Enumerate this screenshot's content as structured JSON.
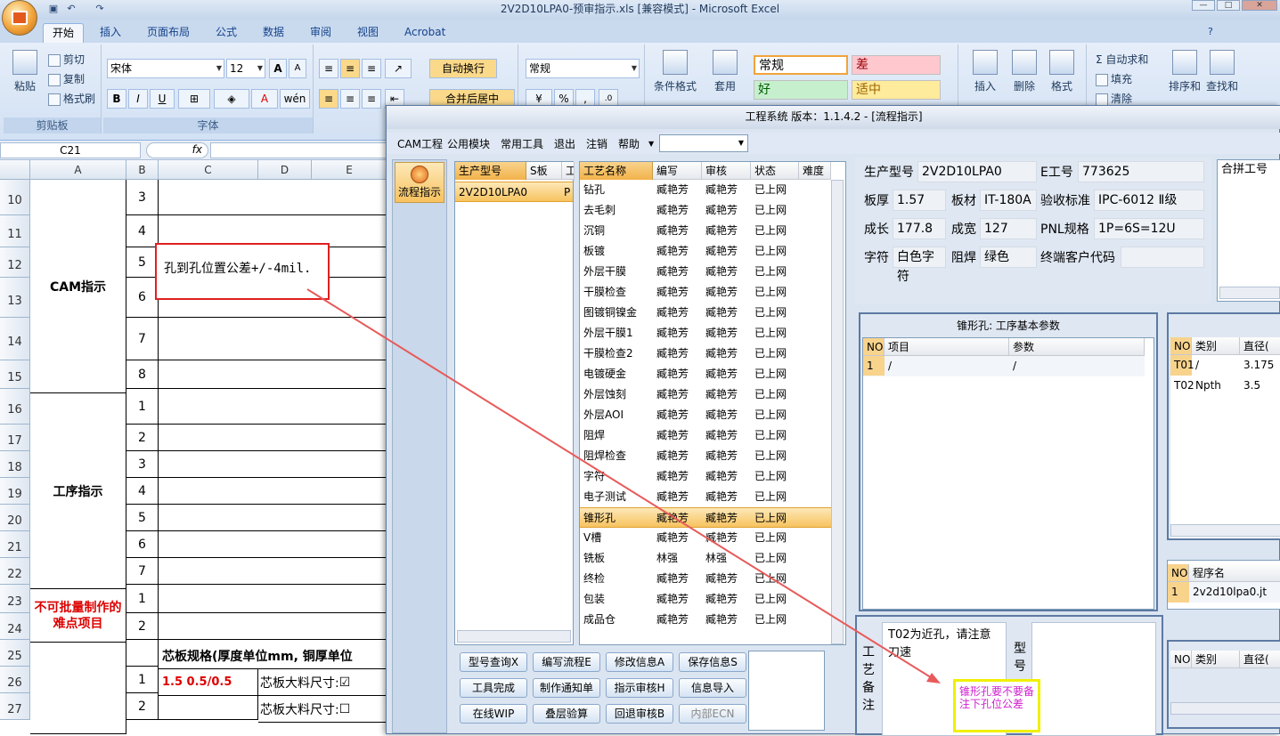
{
  "excel": {
    "title": "2V2D10LPA0-预审指示.xls  [兼容模式] - Microsoft Excel",
    "tabs": [
      "开始",
      "插入",
      "页面布局",
      "公式",
      "数据",
      "审阅",
      "视图",
      "Acrobat"
    ],
    "clipboard": {
      "paste": "粘贴",
      "cut": "剪切",
      "copy": "复制",
      "format_painter": "格式刷",
      "group": "剪贴板"
    },
    "font": {
      "name": "宋体",
      "size": "12",
      "bold": "B",
      "italic": "I",
      "underline": "U",
      "grow": "A",
      "shrink": "A",
      "group": "字体"
    },
    "align": {
      "wrap": "自动换行",
      "merge": "合并后居中"
    },
    "number": {
      "format": "常规"
    },
    "styles": {
      "cond_format": "条件格式",
      "table_format": "套用",
      "normal": "常规",
      "bad": "差",
      "good": "好",
      "neutral": "适中"
    },
    "cells": {
      "insert": "插入",
      "delete": "删除",
      "format": "格式"
    },
    "editing": {
      "autosum": "自动求和",
      "fill": "填充",
      "clear": "清除",
      "sort": "排序和",
      "find": "查找和"
    },
    "namebox": "C21",
    "fx": "fx",
    "columns": [
      "A",
      "B",
      "C",
      "D",
      "E"
    ],
    "rows": [
      {
        "num": "10",
        "b": "3"
      },
      {
        "num": "11",
        "b": "4"
      },
      {
        "num": "12",
        "b": "5"
      },
      {
        "num": "13",
        "b": "6"
      },
      {
        "num": "14",
        "b": "7"
      },
      {
        "num": "15",
        "b": "8"
      },
      {
        "num": "16",
        "b": "1"
      },
      {
        "num": "17",
        "b": "2"
      },
      {
        "num": "18",
        "b": "3"
      },
      {
        "num": "19",
        "b": "4"
      },
      {
        "num": "20",
        "b": "5"
      },
      {
        "num": "21",
        "b": "6"
      },
      {
        "num": "22",
        "b": "7"
      },
      {
        "num": "23",
        "b": "1"
      },
      {
        "num": "24",
        "b": "2"
      },
      {
        "num": "25",
        "b": ""
      },
      {
        "num": "26",
        "b": "1"
      },
      {
        "num": "27",
        "b": "2"
      }
    ],
    "sections": {
      "cam": "CAM指示",
      "process": "工序指示",
      "hard": "不可批量制作的难点项目"
    },
    "annotation": "孔到孔位置公差+/-4mil.",
    "row25_c": "芯板规格(厚度单位mm, 铜厚单位",
    "row26_c": "1.5 0.5/0.5",
    "row26_d": "芯板大料尺寸:",
    "row27_d": "芯板大料尺寸:"
  },
  "app": {
    "title": "工程系统  版本：1.1.4.2 - [流程指示]",
    "menu": [
      "CAM工程",
      "公用模块",
      "常用工具",
      "退出",
      "注销",
      "帮助"
    ],
    "side_btn": "流程指示",
    "model_headers": [
      "生产型号",
      "S板",
      "工"
    ],
    "model_row": "2V2D10LPA0",
    "model_row_tail": "P",
    "process_headers": [
      "工艺名称",
      "编写",
      "审核",
      "状态",
      "难度"
    ],
    "processes": [
      [
        "钻孔",
        "臧艳芳",
        "臧艳芳",
        "已上网"
      ],
      [
        "去毛刺",
        "臧艳芳",
        "臧艳芳",
        "已上网"
      ],
      [
        "沉铜",
        "臧艳芳",
        "臧艳芳",
        "已上网"
      ],
      [
        "板镀",
        "臧艳芳",
        "臧艳芳",
        "已上网"
      ],
      [
        "外层干膜",
        "臧艳芳",
        "臧艳芳",
        "已上网"
      ],
      [
        "干膜检查",
        "臧艳芳",
        "臧艳芳",
        "已上网"
      ],
      [
        "图镀铜镍金",
        "臧艳芳",
        "臧艳芳",
        "已上网"
      ],
      [
        "外层干膜1",
        "臧艳芳",
        "臧艳芳",
        "已上网"
      ],
      [
        "干膜检查2",
        "臧艳芳",
        "臧艳芳",
        "已上网"
      ],
      [
        "电镀硬金",
        "臧艳芳",
        "臧艳芳",
        "已上网"
      ],
      [
        "外层蚀刻",
        "臧艳芳",
        "臧艳芳",
        "已上网"
      ],
      [
        "外层AOI",
        "臧艳芳",
        "臧艳芳",
        "已上网"
      ],
      [
        "阻焊",
        "臧艳芳",
        "臧艳芳",
        "已上网"
      ],
      [
        "阻焊检查",
        "臧艳芳",
        "臧艳芳",
        "已上网"
      ],
      [
        "字符",
        "臧艳芳",
        "臧艳芳",
        "已上网"
      ],
      [
        "电子测试",
        "臧艳芳",
        "臧艳芳",
        "已上网"
      ],
      [
        "锥形孔",
        "臧艳芳",
        "臧艳芳",
        "已上网"
      ],
      [
        "V槽",
        "臧艳芳",
        "臧艳芳",
        "已上网"
      ],
      [
        "铣板",
        "林强",
        "林强",
        "已上网"
      ],
      [
        "终检",
        "臧艳芳",
        "臧艳芳",
        "已上网"
      ],
      [
        "包装",
        "臧艳芳",
        "臧艳芳",
        "已上网"
      ],
      [
        "成品仓",
        "臧艳芳",
        "臧艳芳",
        "已上网"
      ]
    ],
    "selected_index": 16,
    "info": {
      "model_label": "生产型号",
      "model": "2V2D10LPA0",
      "eno_label": "E工号",
      "eno": "773625",
      "thick_label": "板厚",
      "thick": "1.57",
      "mat_label": "板材",
      "mat": "IT-180A",
      "std_label": "验收标准",
      "std": "IPC-6012 Ⅱ级",
      "len_label": "成长",
      "len": "177.8",
      "wid_label": "成宽",
      "wid": "127",
      "pnl_label": "PNL规格",
      "pnl": "1P=6S=12U",
      "char_label": "字符",
      "char": "白色字符",
      "mask_label": "阻焊",
      "mask": "绿色",
      "cust_label": "终端客户代码",
      "cust": "",
      "combine_label": "合拼工号"
    },
    "params": {
      "title": "锥形孔: 工序基本参数",
      "headers": [
        "NO",
        "项目",
        "参数"
      ],
      "row": [
        "1",
        "/",
        "/"
      ]
    },
    "tools": {
      "headers": [
        "NO",
        "类别",
        "直径("
      ],
      "rows": [
        [
          "T01",
          "/",
          "3.175"
        ],
        [
          "T02",
          "Npth",
          "3.5"
        ]
      ]
    },
    "programs": {
      "headers": [
        "NO",
        "程序名"
      ],
      "row": [
        "1",
        "2v2d10lpa0.jt"
      ]
    },
    "tools2": {
      "headers": [
        "NO",
        "类别",
        "直径("
      ]
    },
    "buttons": [
      [
        "型号查询X",
        "编写流程E",
        "修改信息A",
        "保存信息S"
      ],
      [
        "工具完成",
        "制作通知单",
        "指示审核H",
        "信息导入"
      ],
      [
        "在线WIP",
        "叠层验算",
        "回退审核B",
        "内部ECN"
      ]
    ],
    "remark_label": "工艺备注",
    "remark_text": "T02为近孔，请注意刀速",
    "model_side_label": "型号",
    "sticky_note": "锥形孔要不要备注下孔位公差"
  },
  "colors": {
    "accent": "#f2b24a",
    "annotation_box": "#e02020",
    "arrow": "#e85a5a",
    "sticky_border": "#f0f000",
    "sticky_text": "#d020d0"
  }
}
